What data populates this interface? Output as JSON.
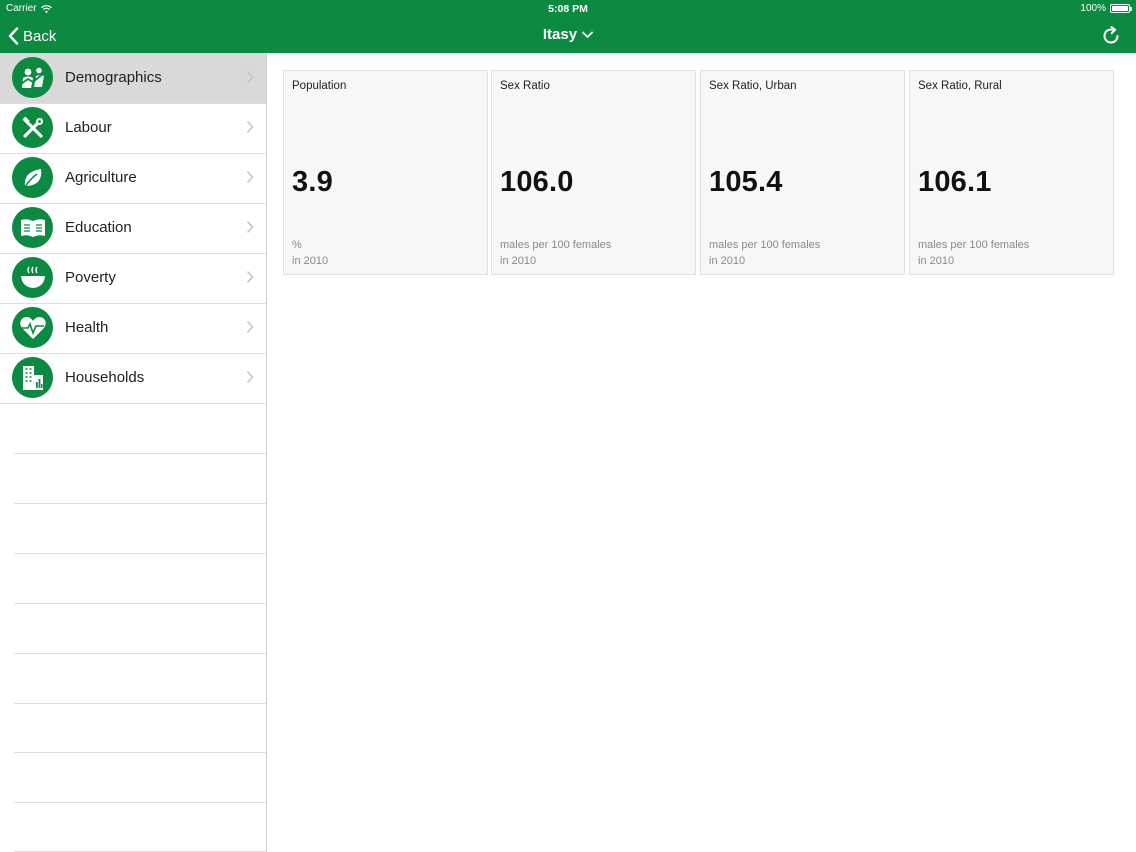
{
  "status_bar": {
    "carrier": "Carrier",
    "time": "5:08 PM",
    "battery": "100%"
  },
  "nav": {
    "back_label": "Back",
    "title": "Itasy"
  },
  "colors": {
    "brand_green": "#0d8a41",
    "active_row": "#d9d9d9",
    "card_bg": "#f7f7f9"
  },
  "sidebar": {
    "items": [
      {
        "label": "Demographics",
        "icon": "demographics-icon",
        "active": true
      },
      {
        "label": "Labour",
        "icon": "tools-icon",
        "active": false
      },
      {
        "label": "Agriculture",
        "icon": "leaf-icon",
        "active": false
      },
      {
        "label": "Education",
        "icon": "book-icon",
        "active": false
      },
      {
        "label": "Poverty",
        "icon": "bowl-icon",
        "active": false
      },
      {
        "label": "Health",
        "icon": "heart-pulse-icon",
        "active": false
      },
      {
        "label": "Households",
        "icon": "buildings-icon",
        "active": false
      }
    ]
  },
  "cards": [
    {
      "title": "Population",
      "value": "3.9",
      "unit": "%",
      "year": "in 2010"
    },
    {
      "title": "Sex Ratio",
      "value": "106.0",
      "unit": "males per 100 females",
      "year": "in 2010"
    },
    {
      "title": "Sex Ratio, Urban",
      "value": "105.4",
      "unit": "males per 100 females",
      "year": "in 2010"
    },
    {
      "title": "Sex Ratio, Rural",
      "value": "106.1",
      "unit": "males per 100 females",
      "year": "in 2010"
    }
  ]
}
